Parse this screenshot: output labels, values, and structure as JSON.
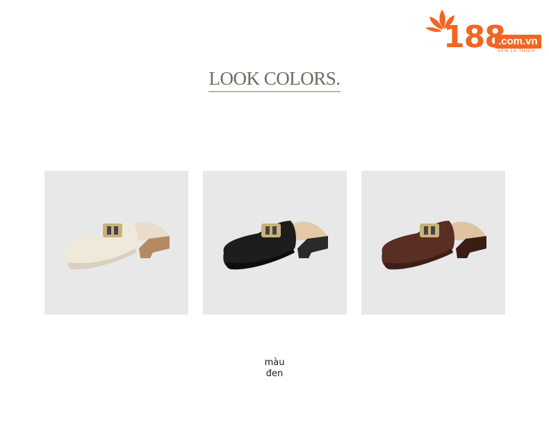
{
  "logo": {
    "number": "188",
    "domain": ".com.vn",
    "tagline": "XEM LÀ THÍCH",
    "brand_color": "#f26522"
  },
  "title": "LOOK COLORS.",
  "products": [
    {
      "color_name": "cream",
      "upper": "#efe9dc",
      "upper_shade": "#d9d0bf",
      "sole": "#b58a63",
      "lining": "#e9dccb"
    },
    {
      "color_name": "black",
      "upper": "#1d1d1d",
      "upper_shade": "#0d0d0d",
      "sole": "#2a2a2a",
      "lining": "#e3c9a6"
    },
    {
      "color_name": "brown",
      "upper": "#5a2e22",
      "upper_shade": "#3e1f17",
      "sole": "#3a1e16",
      "lining": "#e0c4a2"
    }
  ],
  "caption": {
    "line1": "màu",
    "line2": "đen"
  }
}
